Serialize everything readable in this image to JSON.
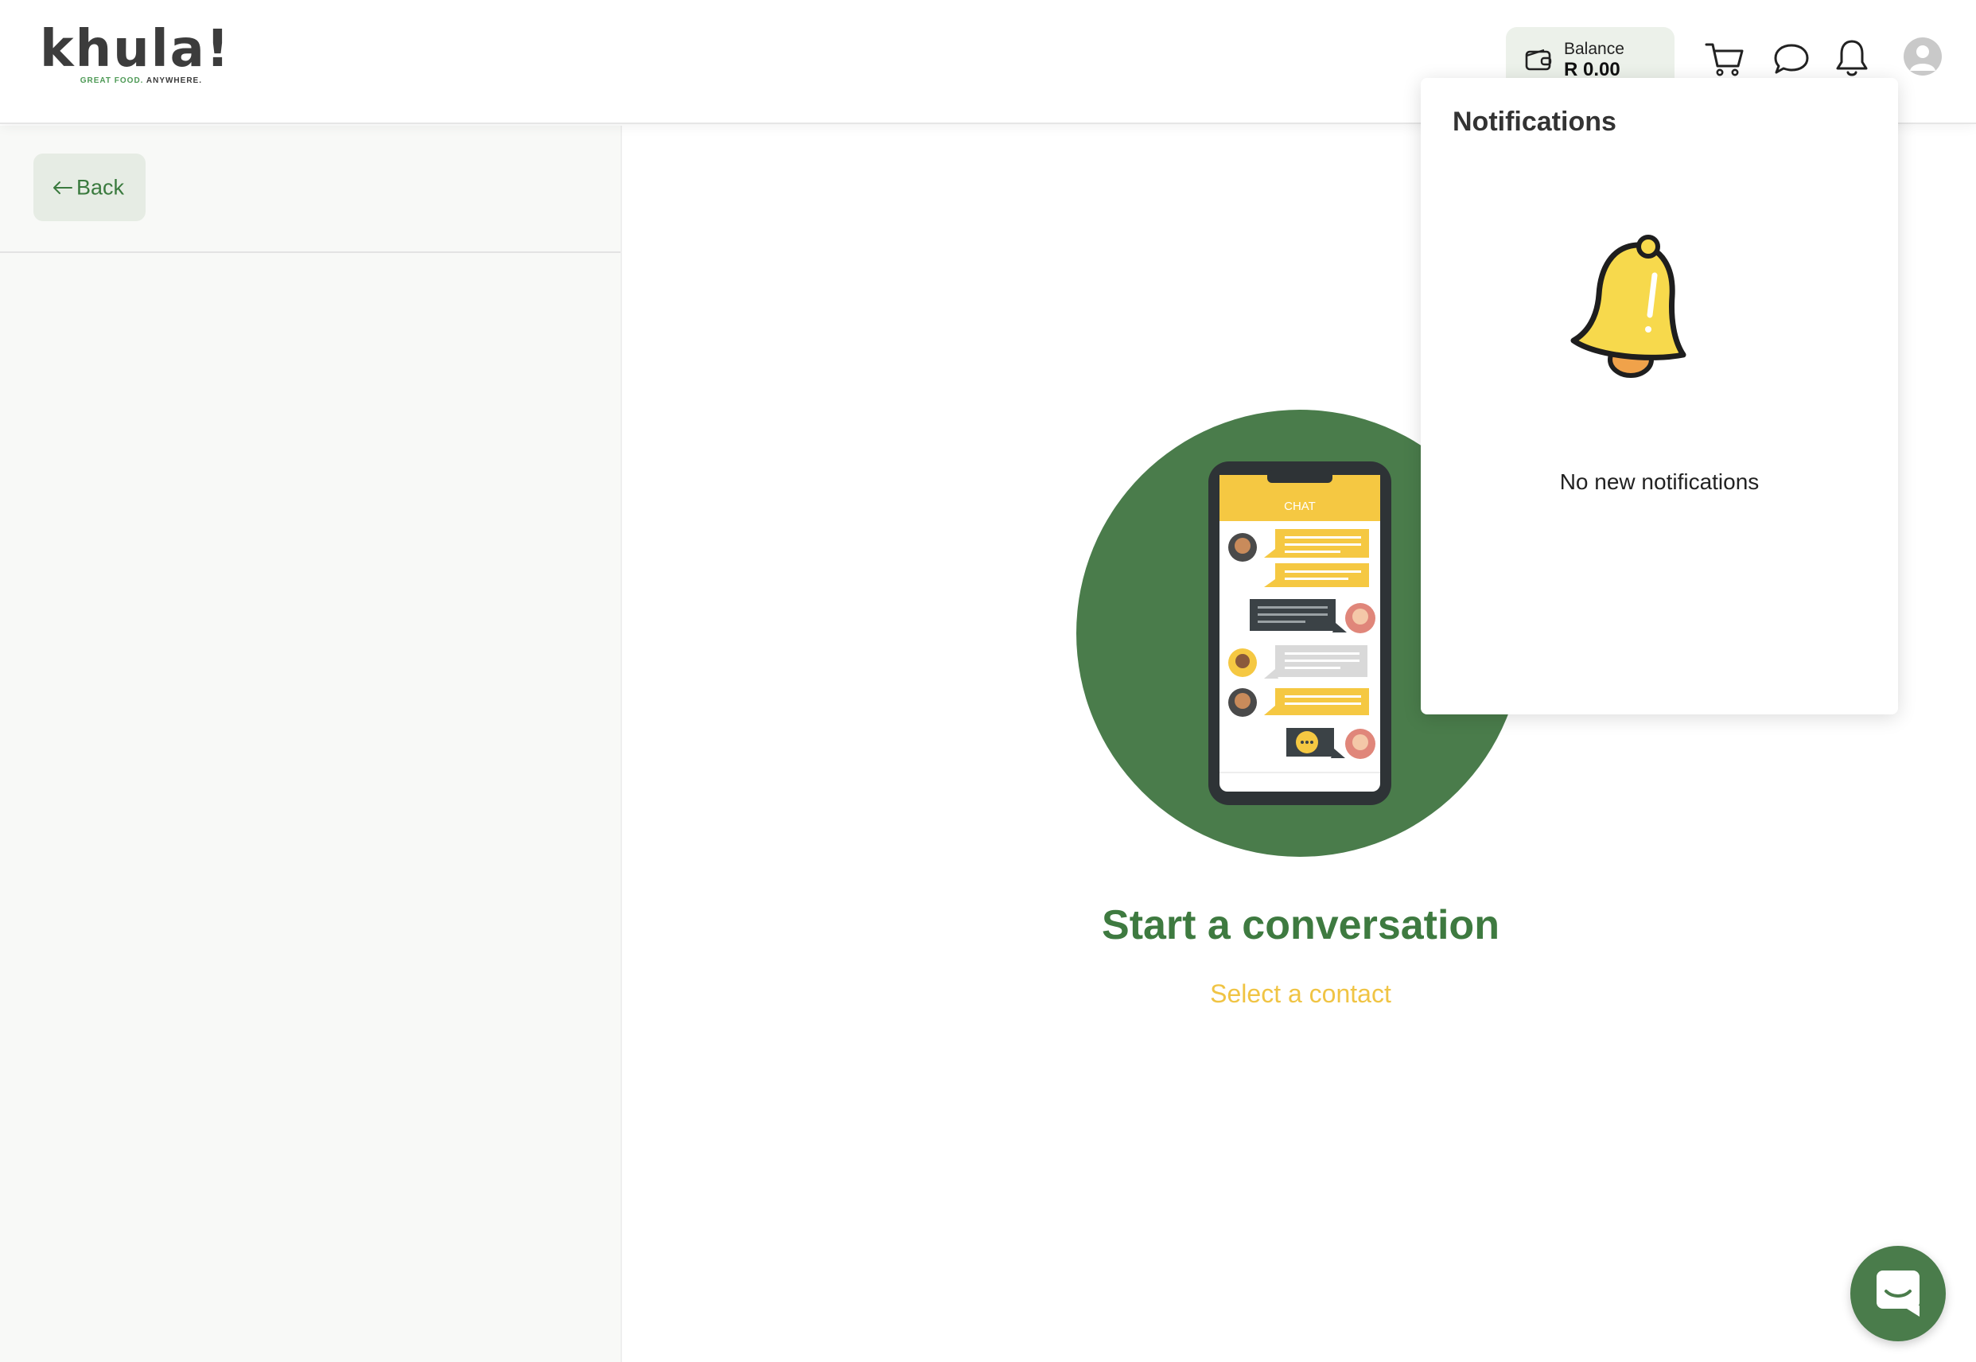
{
  "brand": {
    "logo_text": "khula!",
    "tagline_green": "GREAT FOOD.",
    "tagline_dark": "ANYWHERE."
  },
  "header": {
    "balance_label": "Balance",
    "balance_value": "R 0.00",
    "icons": [
      "wallet-icon",
      "cart-icon",
      "chat-icon",
      "bell-icon",
      "avatar"
    ]
  },
  "sidebar": {
    "back_label": "Back"
  },
  "main": {
    "empty_title": "Start a conversation",
    "empty_subtitle": "Select a contact",
    "illustration_header": "CHAT"
  },
  "notifications": {
    "title": "Notifications",
    "empty_text": "No new notifications"
  },
  "colors": {
    "brand_green": "#4a7c4b",
    "title_green": "#3e7a40",
    "accent_yellow": "#f0c444",
    "sidebar_bg": "#f8f9f7",
    "balance_bg": "#ecf1ea"
  }
}
